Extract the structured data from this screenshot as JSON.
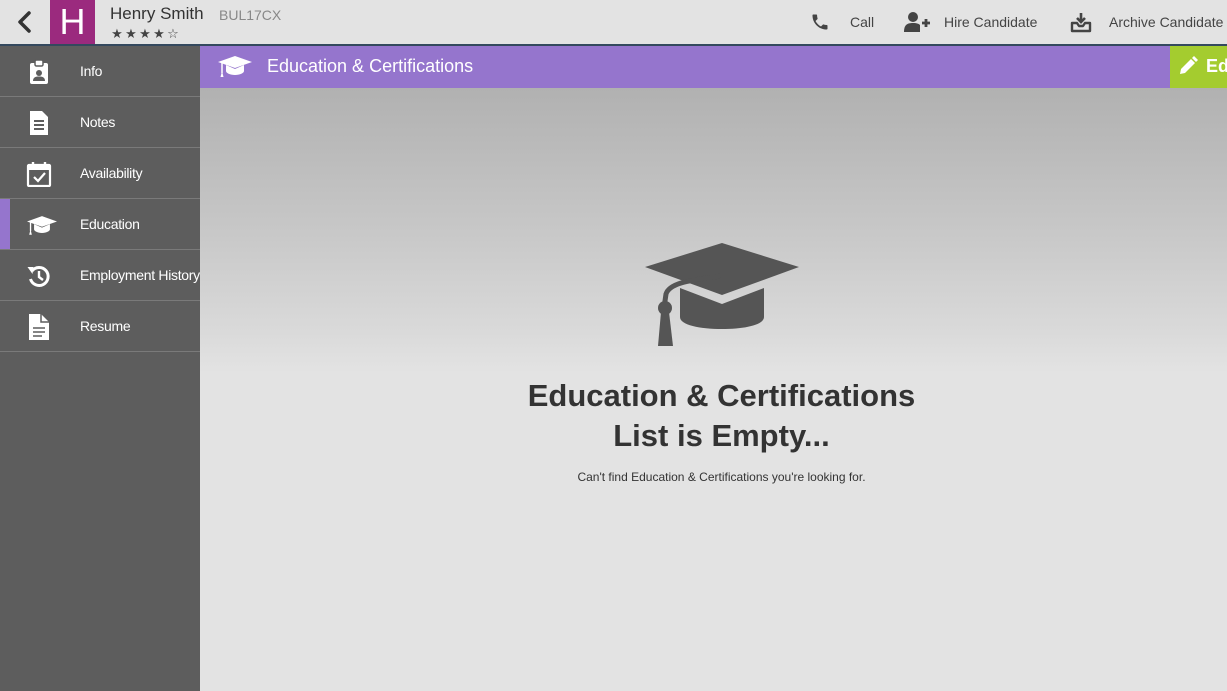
{
  "header": {
    "avatar_letter": "H",
    "candidate_name": "Henry Smith",
    "candidate_code": "BUL17CX",
    "rating": 4,
    "rating_max": 5,
    "actions": {
      "call": "Call",
      "hire": "Hire Candidate",
      "archive": "Archive Candidate"
    }
  },
  "sidebar": {
    "items": [
      {
        "label": "Info",
        "icon": "clipboard-icon"
      },
      {
        "label": "Notes",
        "icon": "document-icon"
      },
      {
        "label": "Availability",
        "icon": "calendar-check-icon"
      },
      {
        "label": "Education",
        "icon": "graduation-cap-icon",
        "active": true
      },
      {
        "label": "Employment History",
        "icon": "history-icon"
      },
      {
        "label": "Resume",
        "icon": "file-text-icon"
      }
    ]
  },
  "main": {
    "section_title": "Education & Certifications",
    "edit_label": "Ed",
    "empty_title_line1": "Education & Certifications",
    "empty_title_line2": "List is Empty...",
    "empty_subtitle": "Can't find Education & Certifications you're looking for."
  },
  "colors": {
    "avatar": "#9b2a7e",
    "accent_purple": "#9575cd",
    "edit_green": "#a4cc2f",
    "sidebar_bg": "#5d5d5d",
    "icon_dark": "#555555"
  }
}
